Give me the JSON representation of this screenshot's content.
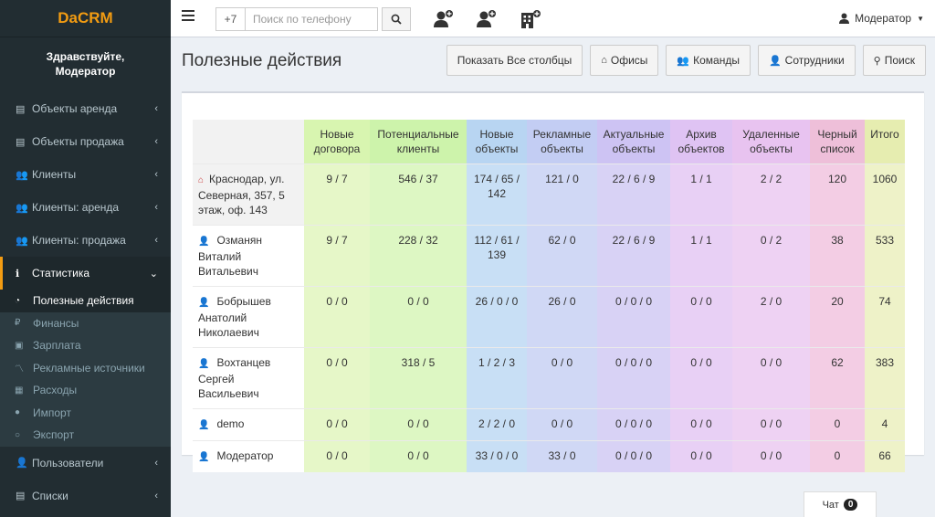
{
  "app": {
    "logo": "DaCRM",
    "greeting_line1": "Здравствуйте,",
    "greeting_line2": "Модератор"
  },
  "sidebar": {
    "items": [
      {
        "label": "Объекты аренда",
        "icon": "building-icon"
      },
      {
        "label": "Объекты продажа",
        "icon": "building-icon"
      },
      {
        "label": "Клиенты",
        "icon": "users-icon"
      },
      {
        "label": "Клиенты: аренда",
        "icon": "users-icon"
      },
      {
        "label": "Клиенты: продажа",
        "icon": "users-icon"
      },
      {
        "label": "Статистика",
        "icon": "info-icon"
      },
      {
        "label": "Пользователи",
        "icon": "user-icon"
      },
      {
        "label": "Списки",
        "icon": "list-icon"
      }
    ],
    "subitems": [
      {
        "label": "Полезные действия",
        "icon": "dashboard-icon"
      },
      {
        "label": "Финансы",
        "icon": "ruble-icon"
      },
      {
        "label": "Зарплата",
        "icon": "money-icon"
      },
      {
        "label": "Рекламные источники",
        "icon": "line-chart-icon"
      },
      {
        "label": "Расходы",
        "icon": "calculator-icon"
      },
      {
        "label": "Импорт",
        "icon": "circle-icon"
      },
      {
        "label": "Экспорт",
        "icon": "circle-outline-icon"
      }
    ]
  },
  "topbar": {
    "phone_prefix": "+7",
    "phone_placeholder": "Поиск по телефону",
    "user_name": "Модератор"
  },
  "header": {
    "title": "Полезные действия",
    "buttons": {
      "show_columns": "Показать Все столбцы",
      "offices": "Офисы",
      "teams": "Команды",
      "employees": "Сотрудники",
      "search": "Поиск"
    }
  },
  "table": {
    "columns": [
      [
        "Новые",
        "договора"
      ],
      [
        "Потенциальные",
        "клиенты"
      ],
      [
        "Новые",
        "объекты"
      ],
      [
        "Рекламные",
        "объекты"
      ],
      [
        "Актуальные",
        "объекты"
      ],
      [
        "Архив",
        "объектов"
      ],
      [
        "Удаленные",
        "объекты"
      ],
      [
        "Черный",
        "список"
      ],
      [
        "Итого",
        ""
      ]
    ],
    "rows": [
      {
        "name1": "Краснодар, ул.",
        "name2": "Северная, 357, 5",
        "name3": "этаж, оф. 143",
        "cells": [
          "9 / 7",
          "546 / 37",
          "174 / 65 /",
          "121 / 0",
          "22 / 6 / 9",
          "1 / 1",
          "2 / 2",
          "120",
          "1060"
        ],
        "extra": "142"
      },
      {
        "name1": "Озманян",
        "name2": "Виталий",
        "name3": "Витальевич",
        "cells": [
          "9 / 7",
          "228 / 32",
          "112 / 61 /",
          "62 / 0",
          "22 / 6 / 9",
          "1 / 1",
          "0 / 2",
          "38",
          "533"
        ],
        "extra": "139"
      },
      {
        "name1": "Бобрышев",
        "name2": "Анатолий",
        "name3": "Николаевич",
        "cells": [
          "0 / 0",
          "0 / 0",
          "26 / 0 / 0",
          "26 / 0",
          "0 / 0 / 0",
          "0 / 0",
          "2 / 0",
          "20",
          "74"
        ],
        "extra": ""
      },
      {
        "name1": "Вохтанцев",
        "name2": "Сергей",
        "name3": "Васильевич",
        "cells": [
          "0 / 0",
          "318 / 5",
          "1 / 2 / 3",
          "0 / 0",
          "0 / 0 / 0",
          "0 / 0",
          "0 / 0",
          "62",
          "383"
        ],
        "extra": ""
      },
      {
        "name1": "demo",
        "name2": "",
        "name3": "",
        "cells": [
          "0 / 0",
          "0 / 0",
          "2 / 2 / 0",
          "0 / 0",
          "0 / 0 / 0",
          "0 / 0",
          "0 / 0",
          "0",
          "4"
        ],
        "extra": ""
      },
      {
        "name1": "Модератор",
        "name2": "",
        "name3": "",
        "cells": [
          "0 / 0",
          "0 / 0",
          "33 / 0 / 0",
          "33 / 0",
          "0 / 0 / 0",
          "0 / 0",
          "0 / 0",
          "0",
          "66"
        ],
        "extra": ""
      }
    ]
  },
  "chat": {
    "label": "Чат",
    "count": "0"
  }
}
